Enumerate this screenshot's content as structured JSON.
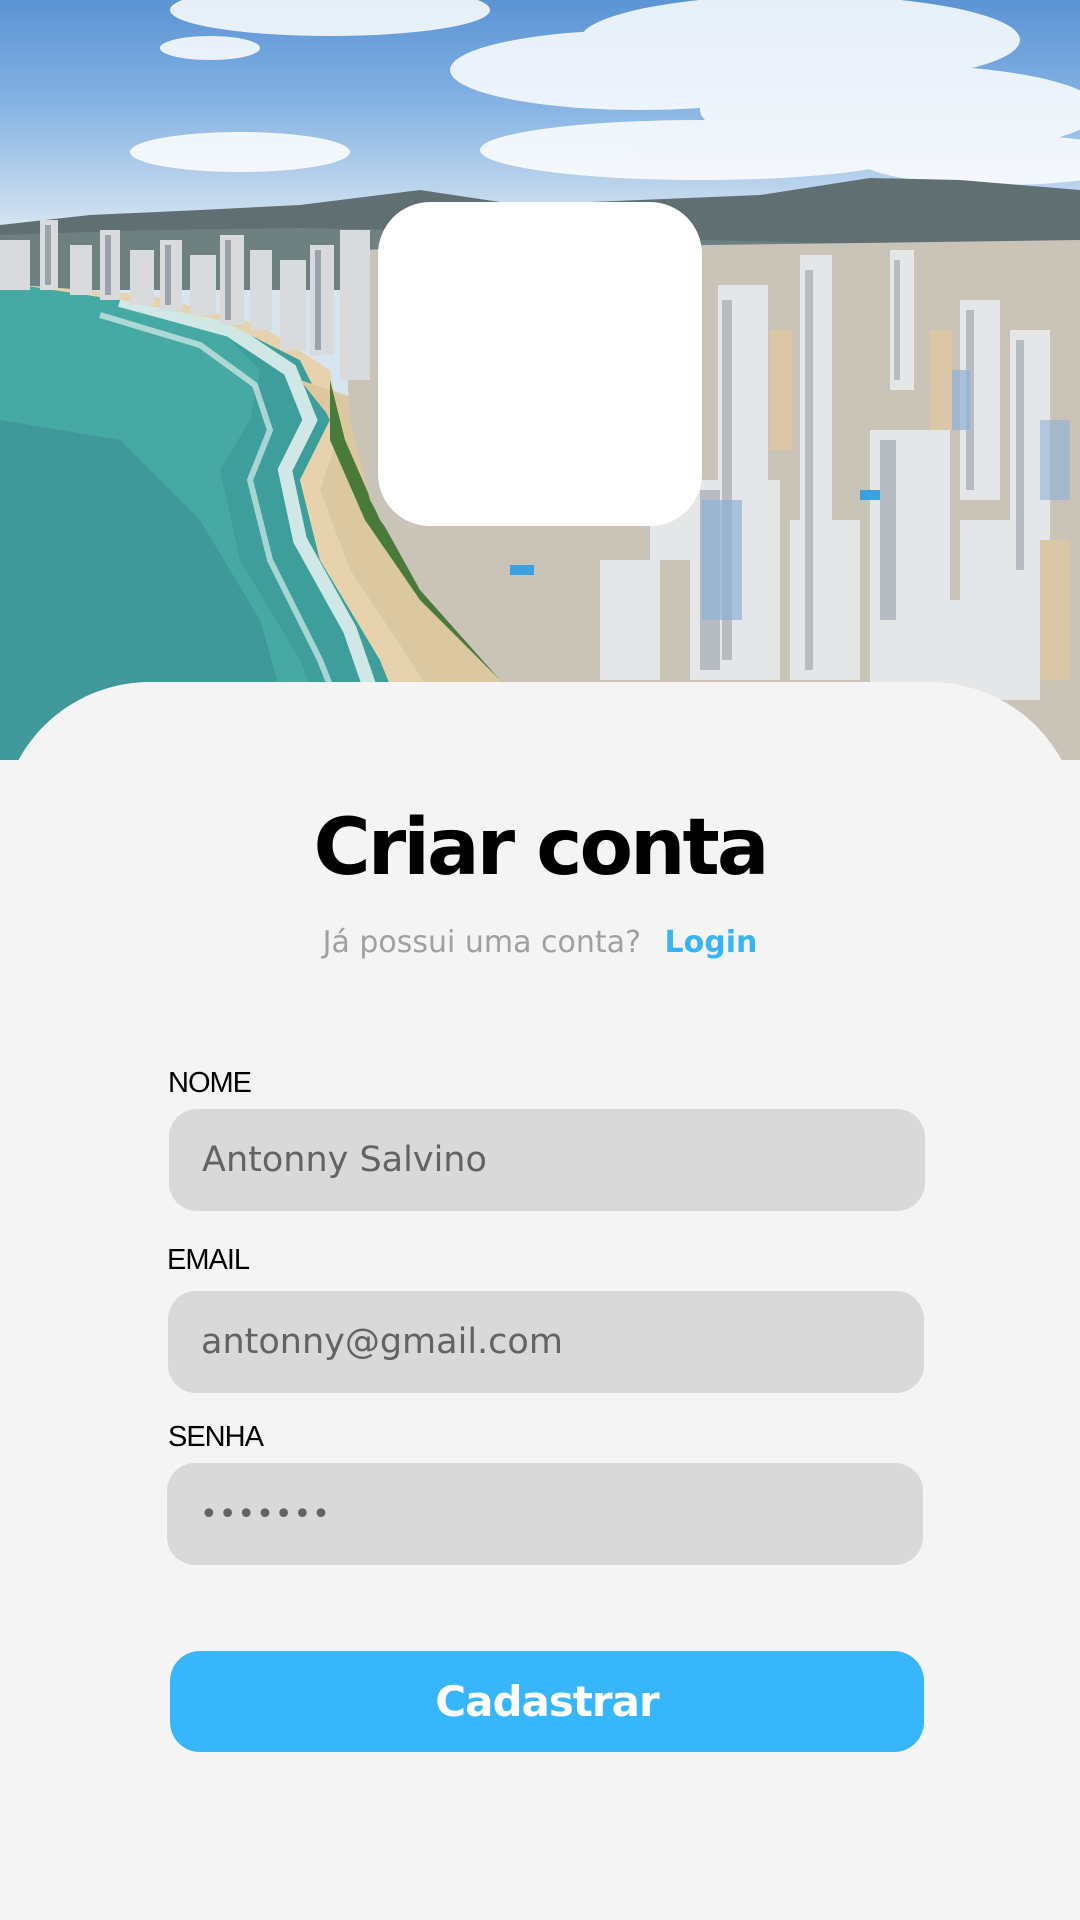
{
  "header": {
    "title": "Criar conta",
    "login_prompt": "Já possui uma conta?",
    "login_link": "Login"
  },
  "form": {
    "name": {
      "label": "NOME",
      "value": "Antonny Salvino"
    },
    "email": {
      "label": "EMAIL",
      "value": "antonny@gmail.com"
    },
    "password": {
      "label": "SENHA",
      "value": "•••••••"
    },
    "submit_label": "Cadastrar"
  },
  "colors": {
    "accent": "#37b6fc",
    "link": "#37b4f5",
    "field_bg": "#d9d9d9",
    "sheet_bg": "#f4f4f4"
  },
  "icons": {
    "logo": "logo-placeholder"
  }
}
